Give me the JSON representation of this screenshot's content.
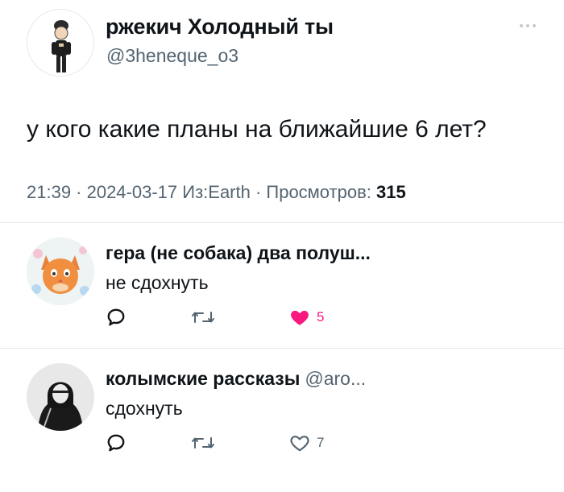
{
  "tweet": {
    "display_name": "ржекич Холодный ты",
    "handle": "@3heneque_o3",
    "text": "у кого какие планы на ближайшие 6 лет?",
    "meta_prefix": "21:39 · 2024-03-17 Из:Earth · Просмотров: ",
    "views": "315",
    "avatar_icon": "person-figure-avatar"
  },
  "replies": [
    {
      "display_name": "гера (не собака) два полуш...",
      "handle": "",
      "text": "не сдохнуть",
      "like_count": "5",
      "liked": true,
      "avatar_icon": "orange-cat-avatar"
    },
    {
      "display_name": "колымские рассказы",
      "handle": "@aro...",
      "text": "сдохнуть",
      "like_count": "7",
      "liked": false,
      "avatar_icon": "hooded-figure-avatar"
    }
  ],
  "colors": {
    "secondary_text": "#536471",
    "like_pink": "#f91880",
    "divider": "#e6e9eb"
  }
}
